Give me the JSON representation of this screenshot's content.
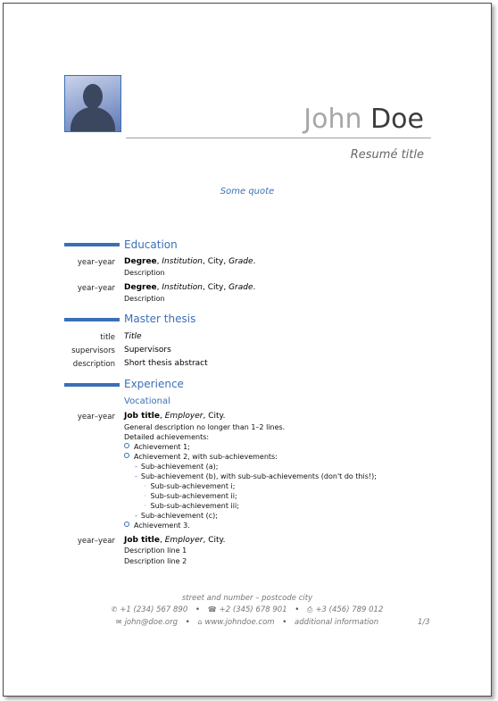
{
  "header": {
    "first_name": "John",
    "last_name": "Doe",
    "title": "Resumé title",
    "quote": "Some quote"
  },
  "education": {
    "heading": "Education",
    "entries": [
      {
        "years": "year–year",
        "degree": "Degree",
        "institution": "Institution",
        "city": ", City, ",
        "grade": "Grade",
        "end": ".",
        "description": "Description"
      },
      {
        "years": "year–year",
        "degree": "Degree",
        "institution": "Institution",
        "city": ", City, ",
        "grade": "Grade",
        "end": ".",
        "description": "Description"
      }
    ]
  },
  "thesis": {
    "heading": "Master thesis",
    "rows": [
      {
        "label": "title",
        "value": "Title"
      },
      {
        "label": "supervisors",
        "value": "Supervisors"
      },
      {
        "label": "description",
        "value": "Short thesis abstract"
      }
    ]
  },
  "experience": {
    "heading": "Experience",
    "subheading": "Vocational",
    "job1": {
      "years": "year–year",
      "title": "Job title",
      "employer": "Employer",
      "city": ", City.",
      "general": "General description no longer than 1–2 lines.",
      "detailed": "Detailed achievements:",
      "a1": "Achievement 1;",
      "a2": "Achievement 2, with sub-achievements:",
      "sa": "Sub-achievement (a);",
      "sb": "Sub-achievement (b), with sub-sub-achievements (don't do this!);",
      "ssi": "Sub-sub-achievement i;",
      "ssii": "Sub-sub-achievement ii;",
      "ssiii": "Sub-sub-achievement iii;",
      "sc": "Sub-achievement (c);",
      "a3": "Achievement 3."
    },
    "job2": {
      "years": "year–year",
      "title": "Job title",
      "employer": "Employer",
      "city": ", City.",
      "line1": "Description line 1",
      "line2": "Description line 2"
    }
  },
  "footer": {
    "address": "street and number – postcode city",
    "mobile": "+1 (234) 567 890",
    "phone": "+2 (345) 678 901",
    "fax": "+3 (456) 789 012",
    "email": "john@doe.org",
    "web": "www.johndoe.com",
    "extra": "additional information",
    "page": "1/3"
  },
  "colors": {
    "accent": "#3b6fb6",
    "name_first": "#a7a7a7",
    "name_last": "#3c3c3c"
  },
  "icons": {
    "mobile": "mobile-icon",
    "phone": "phone-icon",
    "fax": "fax-icon",
    "email": "email-icon",
    "web": "web-icon"
  }
}
